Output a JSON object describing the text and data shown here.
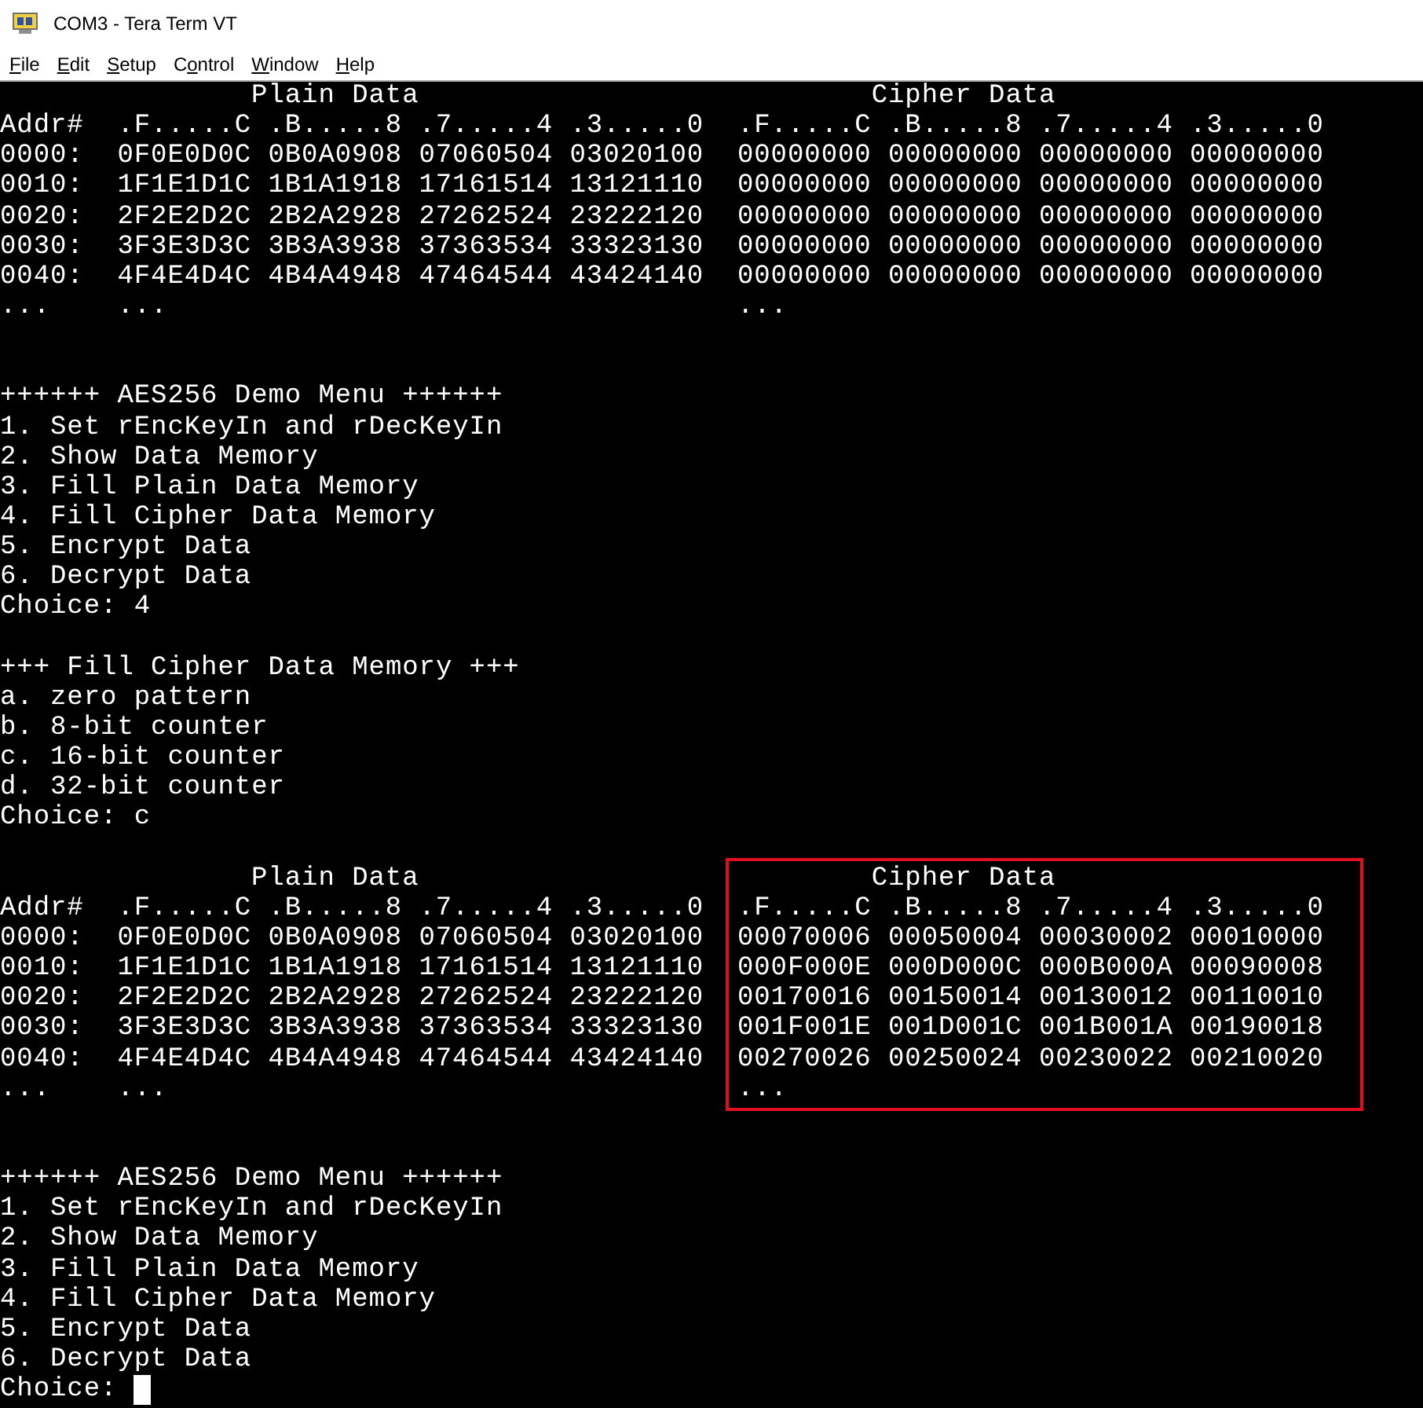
{
  "window": {
    "title": "COM3 - Tera Term VT"
  },
  "menu": [
    {
      "key": "F",
      "rest": "ile"
    },
    {
      "key": "E",
      "rest": "dit"
    },
    {
      "key": "S",
      "rest": "etup"
    },
    {
      "lead": "C",
      "key": "o",
      "rest": "ntrol"
    },
    {
      "key": "W",
      "rest": "indow"
    },
    {
      "key": "H",
      "rest": "elp"
    }
  ],
  "terminal": [
    {
      "kind": "dump",
      "highlighted": false,
      "plain_title": "Plain Data",
      "cipher_title": "Cipher Data",
      "rows": [
        {
          "addr": "Addr#",
          "plain": [
            ".F.....C",
            ".B.....8",
            ".7.....4",
            ".3.....0"
          ],
          "cipher": [
            ".F.....C",
            ".B.....8",
            ".7.....4",
            ".3.....0"
          ]
        },
        {
          "addr": "0000:",
          "plain": [
            "0F0E0D0C",
            "0B0A0908",
            "07060504",
            "03020100"
          ],
          "cipher": [
            "00000000",
            "00000000",
            "00000000",
            "00000000"
          ]
        },
        {
          "addr": "0010:",
          "plain": [
            "1F1E1D1C",
            "1B1A1918",
            "17161514",
            "13121110"
          ],
          "cipher": [
            "00000000",
            "00000000",
            "00000000",
            "00000000"
          ]
        },
        {
          "addr": "0020:",
          "plain": [
            "2F2E2D2C",
            "2B2A2928",
            "27262524",
            "23222120"
          ],
          "cipher": [
            "00000000",
            "00000000",
            "00000000",
            "00000000"
          ]
        },
        {
          "addr": "0030:",
          "plain": [
            "3F3E3D3C",
            "3B3A3938",
            "37363534",
            "33323130"
          ],
          "cipher": [
            "00000000",
            "00000000",
            "00000000",
            "00000000"
          ]
        },
        {
          "addr": "0040:",
          "plain": [
            "4F4E4D4C",
            "4B4A4948",
            "47464544",
            "43424140"
          ],
          "cipher": [
            "00000000",
            "00000000",
            "00000000",
            "00000000"
          ]
        },
        {
          "addr": "...",
          "plain": [
            "..."
          ],
          "cipher": [
            "..."
          ]
        }
      ]
    },
    {
      "kind": "text",
      "lines": [
        "++++++ AES256 Demo Menu ++++++",
        "1. Set rEncKeyIn and rDecKeyIn",
        "2. Show Data Memory",
        "3. Fill Plain Data Memory",
        "4. Fill Cipher Data Memory",
        "5. Encrypt Data",
        "6. Decrypt Data",
        "Choice: 4"
      ]
    },
    {
      "kind": "text",
      "lines": [
        "+++ Fill Cipher Data Memory +++",
        "a. zero pattern",
        "b. 8-bit counter",
        "c. 16-bit counter",
        "d. 32-bit counter",
        "Choice: c"
      ]
    },
    {
      "kind": "dump",
      "highlighted": true,
      "plain_title": "Plain Data",
      "cipher_title": "Cipher Data",
      "rows": [
        {
          "addr": "Addr#",
          "plain": [
            ".F.....C",
            ".B.....8",
            ".7.....4",
            ".3.....0"
          ],
          "cipher": [
            ".F.....C",
            ".B.....8",
            ".7.....4",
            ".3.....0"
          ]
        },
        {
          "addr": "0000:",
          "plain": [
            "0F0E0D0C",
            "0B0A0908",
            "07060504",
            "03020100"
          ],
          "cipher": [
            "00070006",
            "00050004",
            "00030002",
            "00010000"
          ]
        },
        {
          "addr": "0010:",
          "plain": [
            "1F1E1D1C",
            "1B1A1918",
            "17161514",
            "13121110"
          ],
          "cipher": [
            "000F000E",
            "000D000C",
            "000B000A",
            "00090008"
          ]
        },
        {
          "addr": "0020:",
          "plain": [
            "2F2E2D2C",
            "2B2A2928",
            "27262524",
            "23222120"
          ],
          "cipher": [
            "00170016",
            "00150014",
            "00130012",
            "00110010"
          ]
        },
        {
          "addr": "0030:",
          "plain": [
            "3F3E3D3C",
            "3B3A3938",
            "37363534",
            "33323130"
          ],
          "cipher": [
            "001F001E",
            "001D001C",
            "001B001A",
            "00190018"
          ]
        },
        {
          "addr": "0040:",
          "plain": [
            "4F4E4D4C",
            "4B4A4948",
            "47464544",
            "43424140"
          ],
          "cipher": [
            "00270026",
            "00250024",
            "00230022",
            "00210020"
          ]
        },
        {
          "addr": "...",
          "plain": [
            "..."
          ],
          "cipher": [
            "..."
          ]
        }
      ]
    },
    {
      "kind": "text",
      "lines": [
        "++++++ AES256 Demo Menu ++++++",
        "1. Set rEncKeyIn and rDecKeyIn",
        "2. Show Data Memory",
        "3. Fill Plain Data Memory",
        "4. Fill Cipher Data Memory",
        "5. Encrypt Data",
        "6. Decrypt Data"
      ]
    },
    {
      "kind": "prompt",
      "text": "Choice:",
      "cursor": true
    }
  ]
}
